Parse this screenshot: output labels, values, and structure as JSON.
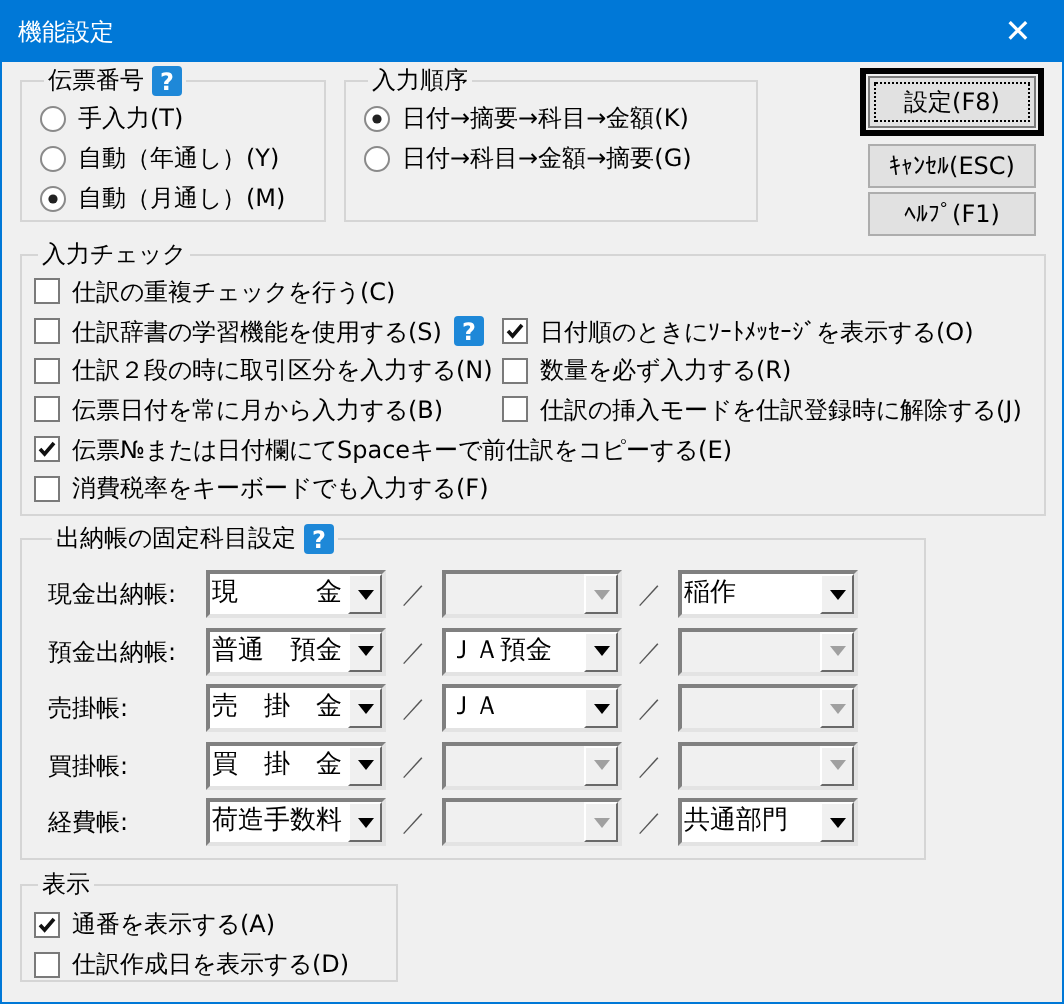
{
  "window": {
    "title": "機能設定",
    "close": "✕"
  },
  "slip_number": {
    "title": "伝票番号",
    "help": "?",
    "options": [
      {
        "label": "手入力(T)",
        "selected": false
      },
      {
        "label": "自動（年通し）(Y)",
        "selected": false
      },
      {
        "label": "自動（月通し）(M)",
        "selected": true
      }
    ]
  },
  "input_order": {
    "title": "入力順序",
    "options": [
      {
        "label": "日付→摘要→科目→金額(K)",
        "selected": true
      },
      {
        "label": "日付→科目→金額→摘要(G)",
        "selected": false
      }
    ]
  },
  "buttons": [
    {
      "label": "設定(F8)",
      "default": true
    },
    {
      "label": "ｷｬﾝｾﾙ(ESC)",
      "default": false
    },
    {
      "label": "ﾍﾙﾌﾟ(F1)",
      "default": false
    }
  ],
  "input_check": {
    "title": "入力チェック",
    "rows": [
      {
        "items": [
          {
            "label": "仕訳の重複チェックを行う(C)",
            "checked": false
          }
        ]
      },
      {
        "items": [
          {
            "label": "仕訳辞書の学習機能を使用する(S)",
            "checked": false,
            "help": "?"
          },
          {
            "label": "日付順のときにｿｰﾄﾒｯｾｰｼﾞを表示する(O)",
            "checked": true
          }
        ]
      },
      {
        "items": [
          {
            "label": "仕訳２段の時に取引区分を入力する(N)",
            "checked": false
          },
          {
            "label": "数量を必ず入力する(R)",
            "checked": false
          }
        ]
      },
      {
        "items": [
          {
            "label": "伝票日付を常に月から入力する(B)",
            "checked": false
          },
          {
            "label": "仕訳の挿入モードを仕訳登録時に解除する(J)",
            "checked": false
          }
        ]
      },
      {
        "items": [
          {
            "label": "伝票№または日付欄にてSpaceキーで前仕訳をコピーする(E)",
            "checked": true
          }
        ]
      },
      {
        "items": [
          {
            "label": "消費税率をキーボードでも入力する(F)",
            "checked": false
          }
        ]
      }
    ]
  },
  "ledger_fixed": {
    "title": "出納帳の固定科目設定",
    "help": "?",
    "rows": [
      {
        "label": "現金出納帳:",
        "separators": [
          "／",
          "／"
        ],
        "fields": [
          {
            "value": "現　　　金",
            "disabled": false
          },
          {
            "disabled": true
          },
          {
            "value": "稲作",
            "disabled": false
          }
        ]
      },
      {
        "label": "預金出納帳:",
        "separators": [
          "／",
          "／"
        ],
        "fields": [
          {
            "value": "普通　預金",
            "disabled": false
          },
          {
            "value": "ＪＡ預金",
            "disabled": false
          },
          {
            "disabled": true
          }
        ]
      },
      {
        "label": "売掛帳:",
        "separators": [
          "／",
          "／"
        ],
        "fields": [
          {
            "value": "売　掛　金",
            "disabled": false
          },
          {
            "value": "ＪＡ",
            "disabled": false
          },
          {
            "disabled": true
          }
        ]
      },
      {
        "label": "買掛帳:",
        "separators": [
          "／",
          "／"
        ],
        "fields": [
          {
            "value": "買　掛　金",
            "disabled": false
          },
          {
            "disabled": true
          },
          {
            "disabled": true
          }
        ]
      },
      {
        "label": "経費帳:",
        "separators": [
          "／",
          "／"
        ],
        "fields": [
          {
            "value": "荷造手数料",
            "disabled": false
          },
          {
            "disabled": true
          },
          {
            "value": "共通部門",
            "disabled": false
          }
        ]
      }
    ]
  },
  "display": {
    "title": "表示",
    "items": [
      {
        "label": "通番を表示する(A)",
        "checked": true
      },
      {
        "label": "仕訳作成日を表示する(D)",
        "checked": false
      }
    ]
  }
}
